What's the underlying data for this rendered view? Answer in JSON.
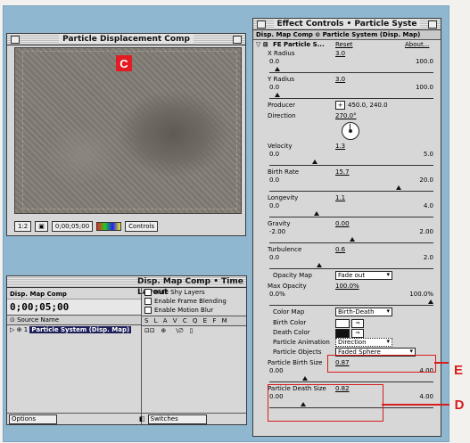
{
  "comp_window": {
    "title": "Particle Displacement Comp",
    "callout_letter": "C",
    "zoom": "1:2",
    "timecode": "0;00;05;00",
    "controls_menu": "Controls"
  },
  "timeline": {
    "title": "Disp. Map Comp • Time Layout",
    "comp_name": "Disp. Map Comp",
    "current_time": "0;00;05;00",
    "source_header": "Source Name",
    "layer_index": "1",
    "layer_name": "Particle System (Disp. Map)",
    "options": [
      "Hide Shy Layers",
      "Enable Frame Blending",
      "Enable Motion Blur"
    ],
    "switch_header": "S L A V C Q E F M",
    "options_menu": "Options",
    "switches_menu": "Switches"
  },
  "effect_controls": {
    "title": "Effect Controls • Particle Syste",
    "header": "Disp. Map Comp ⊙ Particle System (Disp. Map)",
    "effect_name": "FE Particle S...",
    "reset": "Reset",
    "about": "About...",
    "x_radius": {
      "label": "X Radius",
      "value": "3.0",
      "min": "0.0",
      "max": "100.0"
    },
    "y_radius": {
      "label": "Y Radius",
      "value": "3.0",
      "min": "0.0",
      "max": "100.0"
    },
    "producer": {
      "label": "Producer",
      "value": "450.0, 240.0"
    },
    "direction": {
      "label": "Direction",
      "value": "270.0°"
    },
    "velocity": {
      "label": "Velocity",
      "value": "1.3",
      "min": "0.0",
      "max": "5.0"
    },
    "birth_rate": {
      "label": "Birth Rate",
      "value": "15.7",
      "min": "0.0",
      "max": "20.0"
    },
    "longevity": {
      "label": "Longevity",
      "value": "1.1",
      "min": "0.0",
      "max": "4.0"
    },
    "gravity": {
      "label": "Gravity",
      "value": "0.00",
      "min": "-2.00",
      "max": "2.00"
    },
    "turbulence": {
      "label": "Turbulence",
      "value": "0.6",
      "min": "0.0",
      "max": "2.0"
    },
    "opacity_map": {
      "label": "Opacity Map",
      "value": "Fade out"
    },
    "max_opacity": {
      "label": "Max Opacity",
      "value": "100.0%",
      "min": "0.0%",
      "max": "100.0%"
    },
    "color_map": {
      "label": "Color Map",
      "value": "Birth-Death"
    },
    "birth_color": {
      "label": "Birth Color"
    },
    "death_color": {
      "label": "Death Color"
    },
    "particle_animation": {
      "label": "Particle Animation",
      "value": "Direction"
    },
    "particle_objects": {
      "label": "Particle Objects",
      "value": "Faded Sphere"
    },
    "particle_birth_size": {
      "label": "Particle Birth Size",
      "value": "0.87",
      "min": "0.00",
      "max": "4.00"
    },
    "particle_death_size": {
      "label": "Particle Death Size",
      "value": "0.82",
      "min": "0.00",
      "max": "4.00"
    }
  },
  "callouts": {
    "e": "E",
    "d": "D"
  },
  "colors": {
    "accent": "#d61d1d",
    "desktop": "#8fb7cf",
    "selection": "#1e1e5a"
  }
}
